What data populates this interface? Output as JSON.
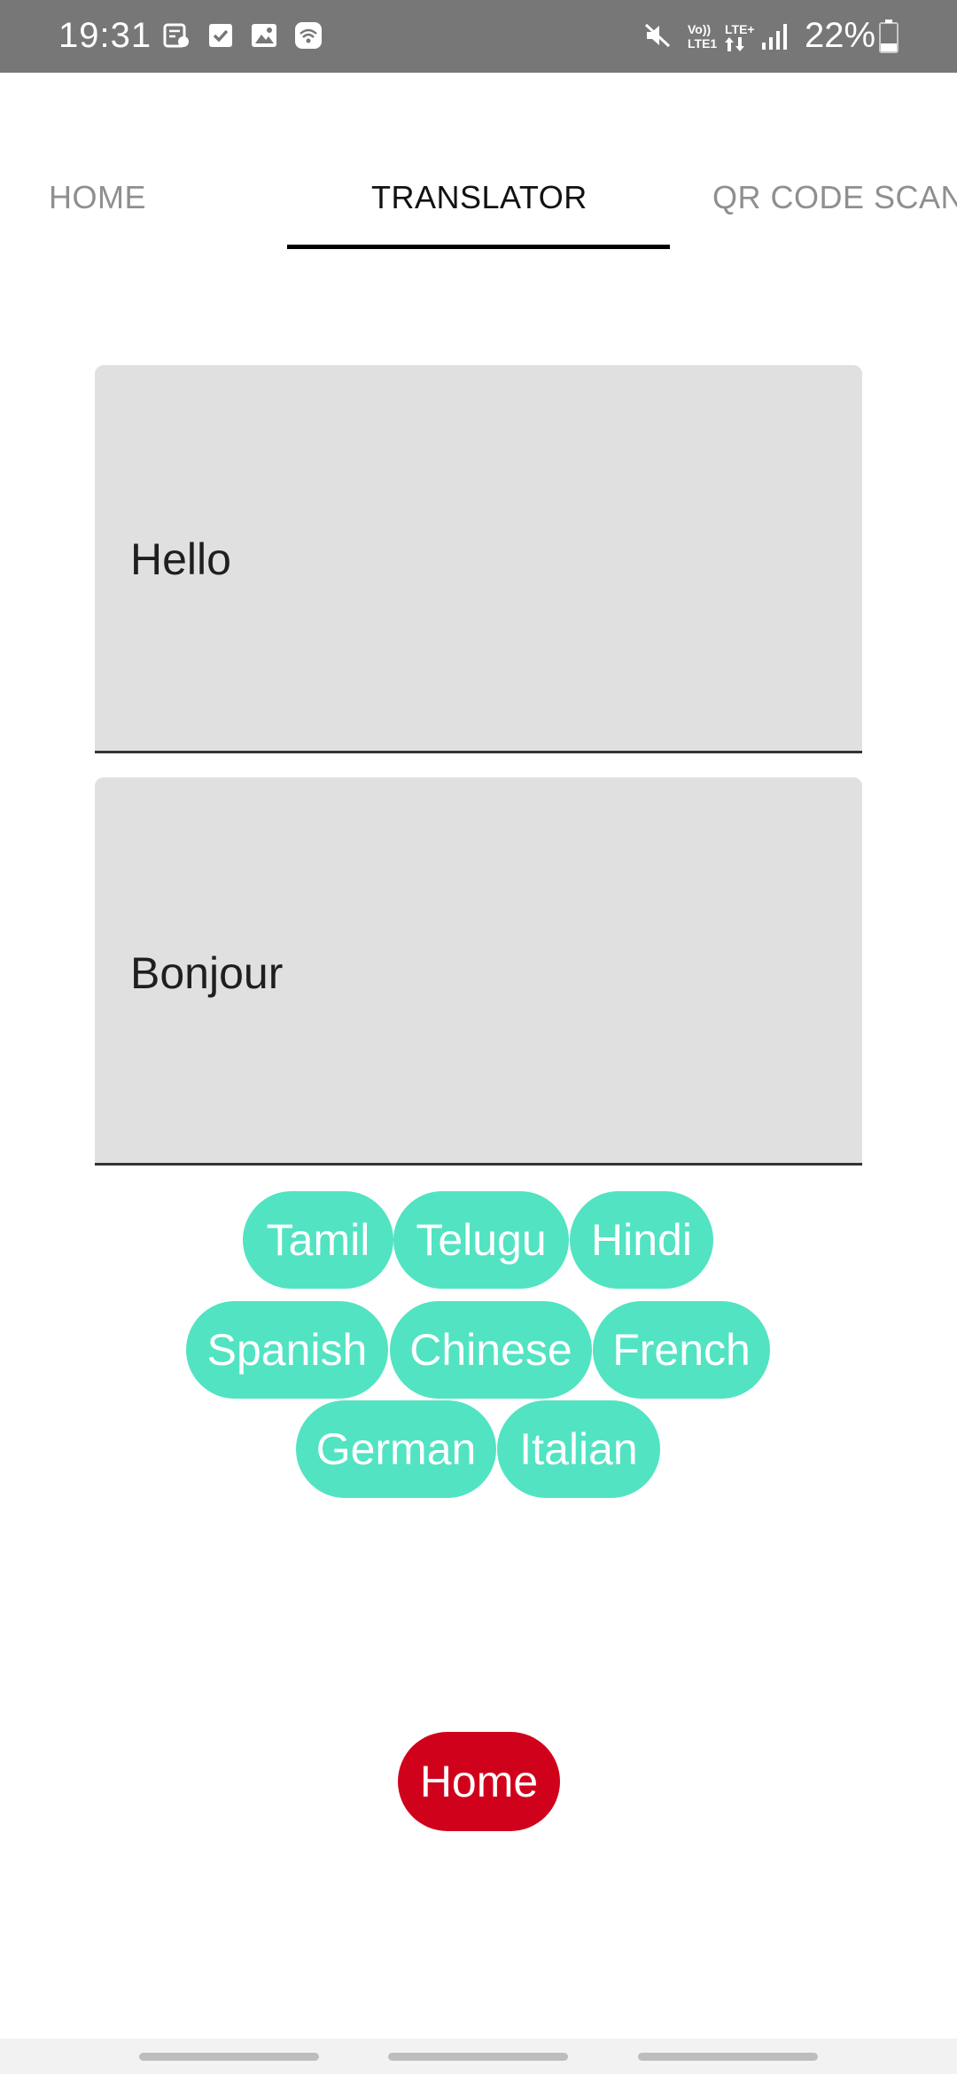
{
  "status_bar": {
    "time": "19:31",
    "volte_label": "Vo))",
    "lte1_label": "LTE1",
    "lte_plus_label": "LTE+",
    "battery_percent": "22%",
    "background_color": "#777777",
    "icons": [
      "notification-icon",
      "checkbox-icon",
      "gallery-icon",
      "wifi-icon",
      "mute-icon",
      "signal-icon",
      "battery-icon"
    ]
  },
  "tabs": [
    {
      "label": "HOME",
      "active": false
    },
    {
      "label": "TRANSLATOR",
      "active": true
    },
    {
      "label": "QR CODE SCANNER",
      "active": false
    }
  ],
  "translator": {
    "input_text": "Hello",
    "output_text": "Bonjour"
  },
  "languages": {
    "row1": [
      "Tamil",
      "Telugu",
      "Hindi"
    ],
    "row2": [
      "Spanish",
      "Chinese",
      "French"
    ],
    "row3": [
      "German",
      "Italian"
    ],
    "chip_color": "#52e3c2"
  },
  "home_button": {
    "label": "Home",
    "color": "#d0021b"
  }
}
